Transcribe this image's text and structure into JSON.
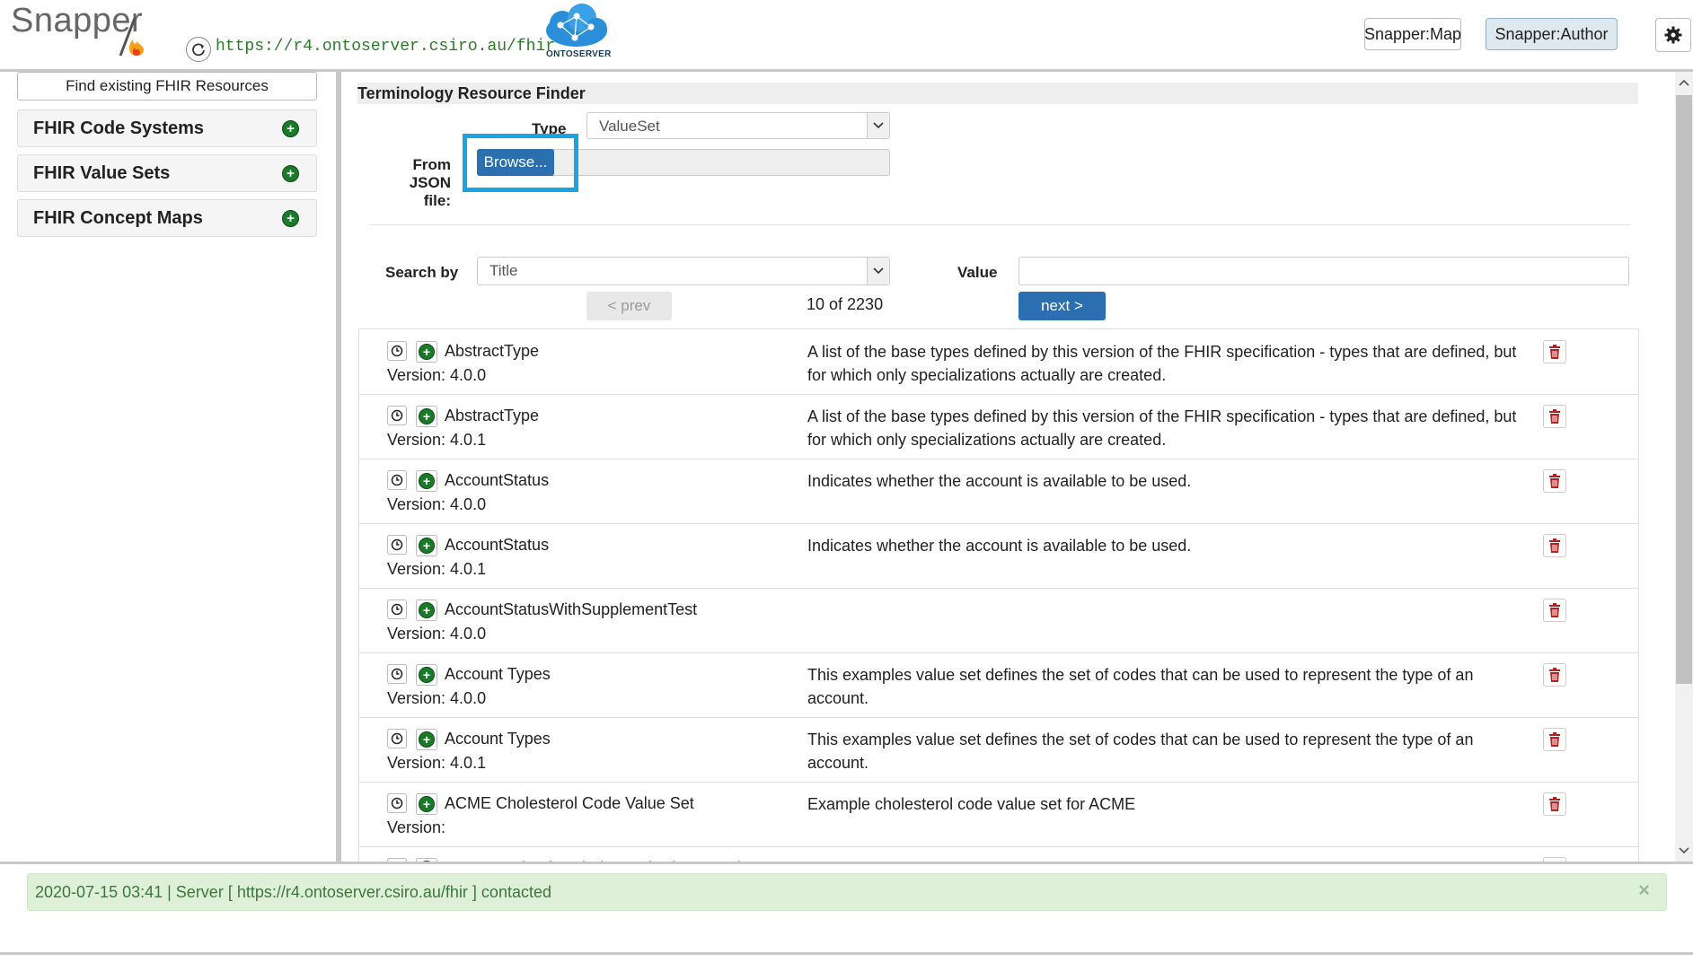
{
  "header": {
    "logo_text": "Snapper",
    "server_url": "https://r4.ontoserver.csiro.au/fhir",
    "ontoserver_label": "ONTOSERVER",
    "nav_buttons": [
      "Snapper:Map",
      "Snapper:Author"
    ],
    "active_nav": "Snapper:Author",
    "settings_icon": "gear-icon"
  },
  "sidebar": {
    "find_button": "Find existing FHIR Resources",
    "items": [
      {
        "label": "FHIR Code Systems"
      },
      {
        "label": "FHIR Value Sets"
      },
      {
        "label": "FHIR Concept Maps"
      }
    ]
  },
  "finder": {
    "title": "Terminology Resource Finder",
    "type_label": "Type",
    "type_value": "ValueSet",
    "from_json_label_1": "From JSON",
    "from_json_label_2": "file:",
    "browse_label": "Browse...",
    "search_by_label": "Search by",
    "search_by_value": "Title",
    "value_label": "Value",
    "value_input": "",
    "prev_label": "< prev",
    "next_label": "next >",
    "page_info": "10 of 2230"
  },
  "results": [
    {
      "name": "AbstractType",
      "version": "Version: 4.0.0",
      "description": "A list of the base types defined by this version of the FHIR specification - types that are defined, but for which only specializations actually are created."
    },
    {
      "name": "AbstractType",
      "version": "Version: 4.0.1",
      "description": "A list of the base types defined by this version of the FHIR specification - types that are defined, but for which only specializations actually are created."
    },
    {
      "name": "AccountStatus",
      "version": "Version: 4.0.0",
      "description": "Indicates whether the account is available to be used."
    },
    {
      "name": "AccountStatus",
      "version": "Version: 4.0.1",
      "description": "Indicates whether the account is available to be used."
    },
    {
      "name": "AccountStatusWithSupplementTest",
      "version": "Version: 4.0.0",
      "description": ""
    },
    {
      "name": "Account Types",
      "version": "Version: 4.0.0",
      "description": "This examples value set defines the set of codes that can be used to represent the type of an account."
    },
    {
      "name": "Account Types",
      "version": "Version: 4.0.1",
      "description": "This examples value set defines the set of codes that can be used to represent the type of an account."
    },
    {
      "name": "ACME Cholesterol Code Value Set",
      "version": "Version:",
      "description": "Example cholesterol code value set for ACME"
    },
    {
      "name": "ACME Codes for Cholesterol: Plasma only",
      "version": "",
      "description": "ACME Codes for Cholesterol: Plasma only - demonstrating the use of a filter defined in a"
    }
  ],
  "status": {
    "message": "2020-07-15 03:41 | Server [ https://r4.ontoserver.csiro.au/fhir ] contacted",
    "close": "×"
  },
  "colors": {
    "primary_button": "#2b6fb0",
    "highlight": "#1aa5e0",
    "add_icon": "#1a7a2a",
    "trash_icon": "#b22222",
    "status_bg": "#dff0d8"
  }
}
